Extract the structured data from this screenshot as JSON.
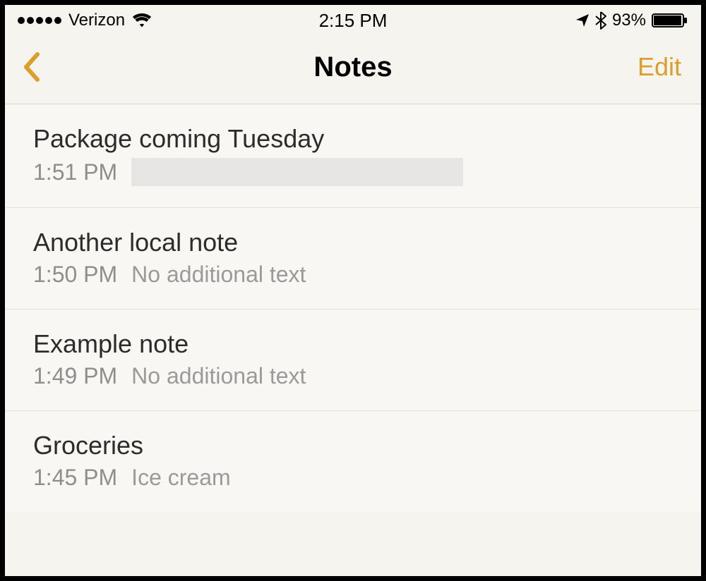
{
  "status": {
    "carrier": "Verizon",
    "time": "2:15 PM",
    "battery_pct": "93%"
  },
  "nav": {
    "title": "Notes",
    "edit_label": "Edit"
  },
  "notes": [
    {
      "title": "Package coming Tuesday",
      "time": "1:51 PM",
      "preview": "",
      "redacted": true
    },
    {
      "title": "Another local note",
      "time": "1:50 PM",
      "preview": "No additional text",
      "redacted": false
    },
    {
      "title": "Example note",
      "time": "1:49 PM",
      "preview": "No additional text",
      "redacted": false
    },
    {
      "title": "Groceries",
      "time": "1:45 PM",
      "preview": "Ice cream",
      "redacted": false
    }
  ],
  "colors": {
    "accent": "#dc9e2c",
    "bg": "#f6f4ef",
    "list_bg": "#f8f7f3",
    "divider": "#e2dfd9"
  }
}
